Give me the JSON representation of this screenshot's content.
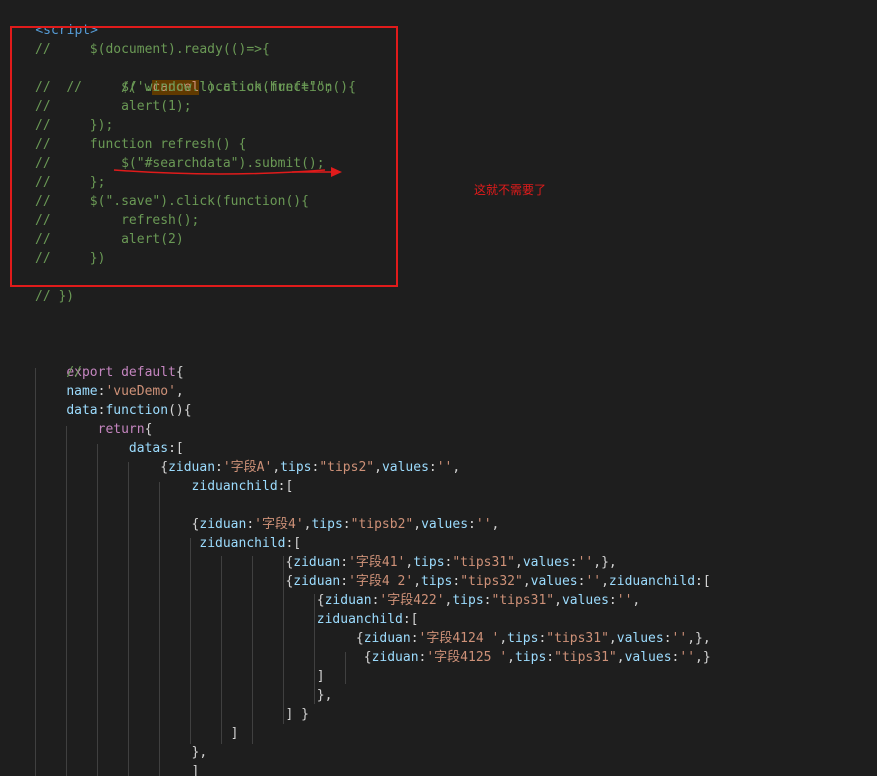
{
  "code": {
    "open_tag": "<script>",
    "comment_block": [
      "//     $(document).ready(()=>{",
      "//     $('.cancel').click(function(){",
      "//         // window.location.href=\"\";",
      "//         alert(1);",
      "//     });",
      "//     function refresh() {",
      "//         $(\"#searchdata\").submit();",
      "//     };",
      "//     $(\".save\").click(function(){",
      "//         refresh();",
      "//         alert(2)",
      "//     })"
    ],
    "comment_end": "// })",
    "export_lines": [
      "export default{",
      "    //",
      "    name:'vueDemo',",
      "    data:function(){",
      "        return{",
      "            datas:[",
      "                {ziduan:'字段A',tips:\"tips2\",values:'',",
      "                    ziduanchild:[",
      "",
      "                    {ziduan:'字段4',tips:\"tipsb2\",values:'',",
      "                     ziduanchild:[",
      "                                {ziduan:'字段41',tips:\"tips31\",values:'',},",
      "                                {ziduan:'字段4 2',tips:\"tips32\",values:'',ziduanchild:[",
      "                                    {ziduan:'字段422',tips:\"tips31\",values:'',",
      "                                    ziduanchild:[",
      "                                         {ziduan:'字段4124 ',tips:\"tips31\",values:'',},",
      "                                          {ziduan:'字段4125 ',tips:\"tips31\",values:'',}",
      "                                    ]",
      "                                    },",
      "                                ] }",
      "                         ]",
      "                    },",
      "                    ]"
    ]
  },
  "annotation": {
    "note": "这就不需要了",
    "color": "#e01b1b"
  },
  "theme": {
    "background": "#1e1e1e",
    "comment": "#6a9955",
    "keyword": "#c586c0",
    "property": "#9cdcfe",
    "string": "#ce9178"
  }
}
